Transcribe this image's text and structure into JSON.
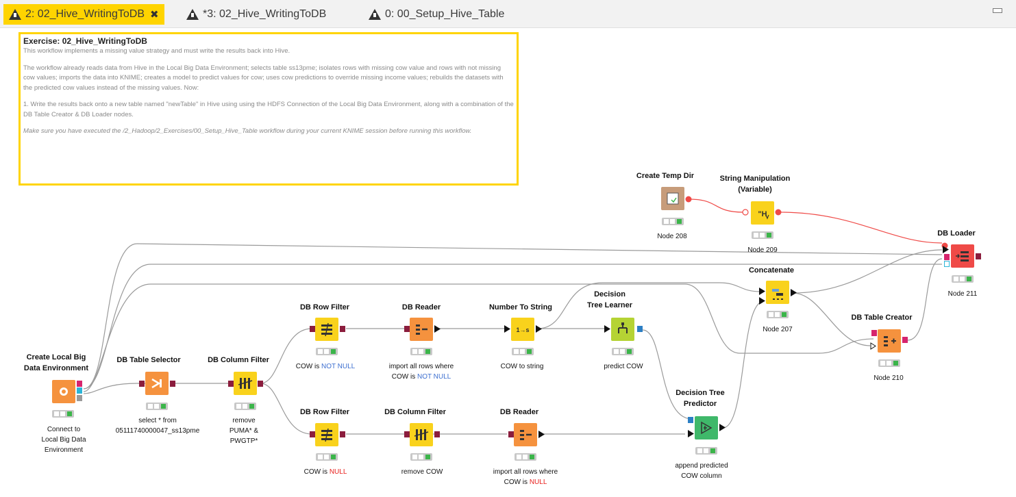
{
  "tabs": [
    {
      "label": "2: 02_Hive_WritingToDB",
      "active": true,
      "close": "✖"
    },
    {
      "label": "*3: 02_Hive_WritingToDB",
      "active": false
    },
    {
      "label": "0: 00_Setup_Hive_Table",
      "active": false
    }
  ],
  "annotation": {
    "title": "Exercise: 02_Hive_WritingToDB",
    "p1": "This workflow implements a missing value strategy and must write the results back into Hive.",
    "p2": "The workflow already reads data from Hive in the Local Big Data Environment;  selects table ss13pme; isolates rows with missing cow value and rows with not missing cow values; imports the data into KNIME; creates a model to predict values for cow; uses cow predictions to override missing income values; rebuilds the datasets with the predicted cow values instead of the missing values. Now:",
    "p3": "1. Write the results back onto a new table named \"newTable\" in Hive using using the HDFS Connection of the Local Big Data Environment, along with a combination of the DB Table Creator & DB Loader nodes.",
    "p4": "Make sure you have executed the /2_Hadoop/2_Exercises/00_Setup_Hive_Table workflow during your current KNIME session before running this workflow."
  },
  "nodes": {
    "create_env": {
      "title": "Create Local Big\nData Environment",
      "label": "Connect to\nLocal Big Data\nEnvironment",
      "color": "#f5923e"
    },
    "table_selector": {
      "title": "DB Table Selector",
      "label": "select * from\n05111740000047_ss13pme",
      "color": "#f5923e"
    },
    "col_filter_1": {
      "title": "DB Column Filter",
      "label": "remove\nPUMA* &\nPWGTP*",
      "color": "#f9d21c"
    },
    "row_filter_1": {
      "title": "DB Row Filter",
      "label_a": "COW is ",
      "label_b": "NOT NULL",
      "color": "#f9d21c"
    },
    "reader_1": {
      "title": "DB Reader",
      "label_a": "import all rows where\nCOW is ",
      "label_b": "NOT NULL",
      "color": "#f5923e"
    },
    "num_to_str": {
      "title": "Number To String",
      "label": "COW to string",
      "color": "#f9d21c"
    },
    "tree_learner": {
      "title": "Decision\nTree Learner",
      "label": "predict COW",
      "color": "#b5d334"
    },
    "row_filter_2": {
      "title": "DB Row Filter",
      "label_a": "COW is ",
      "label_b": "NULL",
      "color": "#f9d21c"
    },
    "col_filter_2": {
      "title": "DB Column Filter",
      "label": "remove COW",
      "color": "#f9d21c"
    },
    "reader_2": {
      "title": "DB Reader",
      "label_a": "import all rows where\nCOW is ",
      "label_b": "NULL",
      "color": "#f5923e"
    },
    "tree_predictor": {
      "title": "Decision Tree\nPredictor",
      "label": "append predicted\nCOW column",
      "color": "#3fb86a"
    },
    "concatenate": {
      "title": "Concatenate",
      "label": "Node 207",
      "color": "#f9d21c"
    },
    "temp_dir": {
      "title": "Create Temp Dir",
      "label": "Node 208",
      "color": "#c79c7a"
    },
    "string_manip": {
      "title": "String Manipulation\n(Variable)",
      "label": "Node 209",
      "color": "#f9d21c"
    },
    "table_creator": {
      "title": "DB Table Creator",
      "label": "Node 210",
      "color": "#f5923e"
    },
    "loader": {
      "title": "DB Loader",
      "label": "Node 211",
      "color": "#ef4a47"
    }
  },
  "colors": {
    "accent": "#ffd400",
    "variable_link": "#ef4a47",
    "not_null": "#3d6fd0",
    "null": "#e8201d",
    "status_green": "#3bb54a"
  }
}
